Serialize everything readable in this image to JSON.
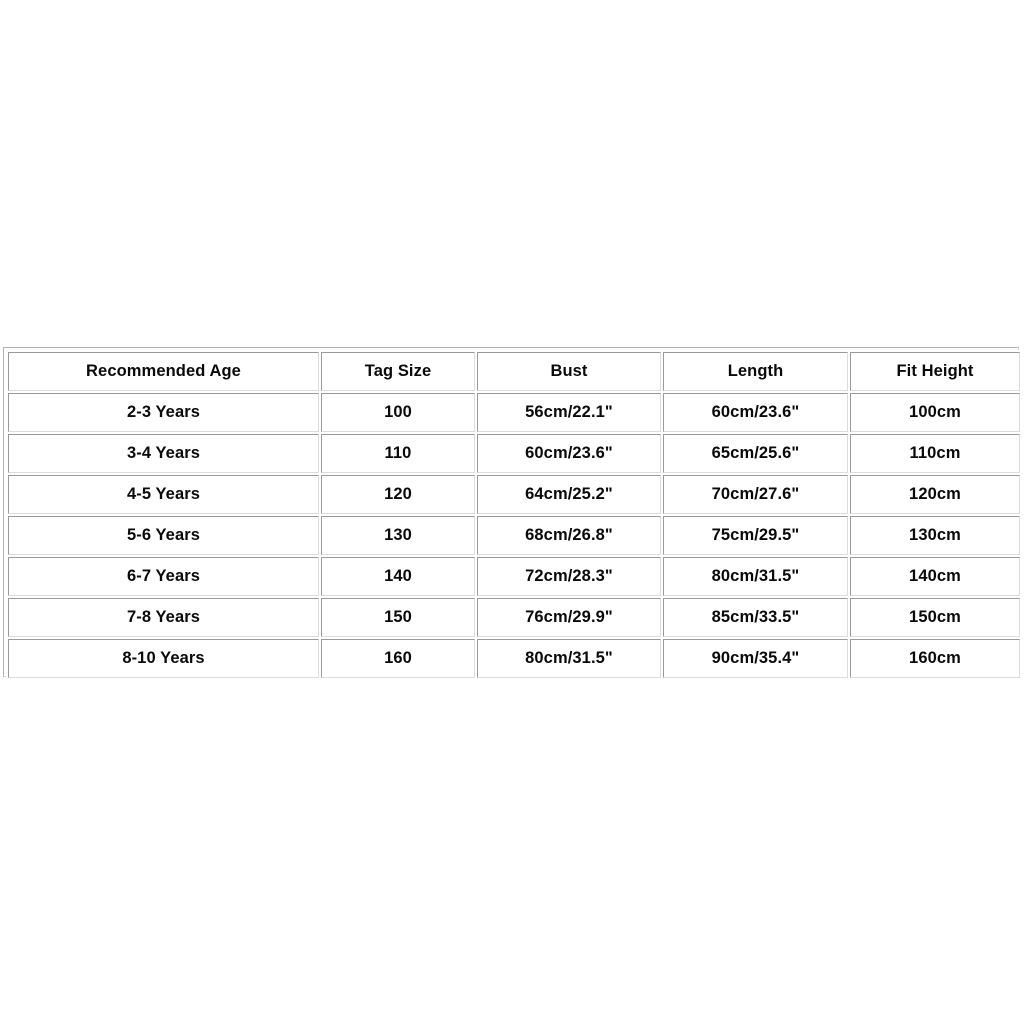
{
  "chart_data": {
    "type": "table",
    "title": "",
    "columns": [
      "Recommended Age",
      "Tag Size",
      "Bust",
      "Length",
      "Fit Height"
    ],
    "rows": [
      [
        "2-3 Years",
        "100",
        "56cm/22.1\"",
        "60cm/23.6\"",
        "100cm"
      ],
      [
        "3-4 Years",
        "110",
        "60cm/23.6\"",
        "65cm/25.6\"",
        "110cm"
      ],
      [
        "4-5 Years",
        "120",
        "64cm/25.2\"",
        "70cm/27.6\"",
        "120cm"
      ],
      [
        "5-6 Years",
        "130",
        "68cm/26.8\"",
        "75cm/29.5\"",
        "130cm"
      ],
      [
        "6-7 Years",
        "140",
        "72cm/28.3\"",
        "80cm/31.5\"",
        "140cm"
      ],
      [
        "7-8 Years",
        "150",
        "76cm/29.9\"",
        "85cm/33.5\"",
        "150cm"
      ],
      [
        "8-10 Years",
        "160",
        "80cm/31.5\"",
        "90cm/35.4\"",
        "160cm"
      ]
    ]
  },
  "size_chart": {
    "headers": {
      "recommended_age": "Recommended Age",
      "tag_size": "Tag Size",
      "bust": "Bust",
      "length": "Length",
      "fit_height": "Fit Height"
    },
    "rows": [
      {
        "age": "2-3 Years",
        "tag": "100",
        "bust": "56cm/22.1\"",
        "length": "60cm/23.6\"",
        "fit": "100cm"
      },
      {
        "age": "3-4 Years",
        "tag": "110",
        "bust": "60cm/23.6\"",
        "length": "65cm/25.6\"",
        "fit": "110cm"
      },
      {
        "age": "4-5 Years",
        "tag": "120",
        "bust": "64cm/25.2\"",
        "length": "70cm/27.6\"",
        "fit": "120cm"
      },
      {
        "age": "5-6 Years",
        "tag": "130",
        "bust": "68cm/26.8\"",
        "length": "75cm/29.5\"",
        "fit": "130cm"
      },
      {
        "age": "6-7 Years",
        "tag": "140",
        "bust": "72cm/28.3\"",
        "length": "80cm/31.5\"",
        "fit": "140cm"
      },
      {
        "age": "7-8 Years",
        "tag": "150",
        "bust": "76cm/29.9\"",
        "length": "85cm/33.5\"",
        "fit": "150cm"
      },
      {
        "age": "8-10 Years",
        "tag": "160",
        "bust": "80cm/31.5\"",
        "length": "90cm/35.4\"",
        "fit": "160cm"
      }
    ]
  },
  "colors": {
    "page_background": "#ffffff",
    "cell_background": "#ffffff",
    "text": "#0a0a0a",
    "border_dark": "#9a9a9a",
    "border_light": "#dcdcdc",
    "outer_border": "#b3b3b3"
  }
}
